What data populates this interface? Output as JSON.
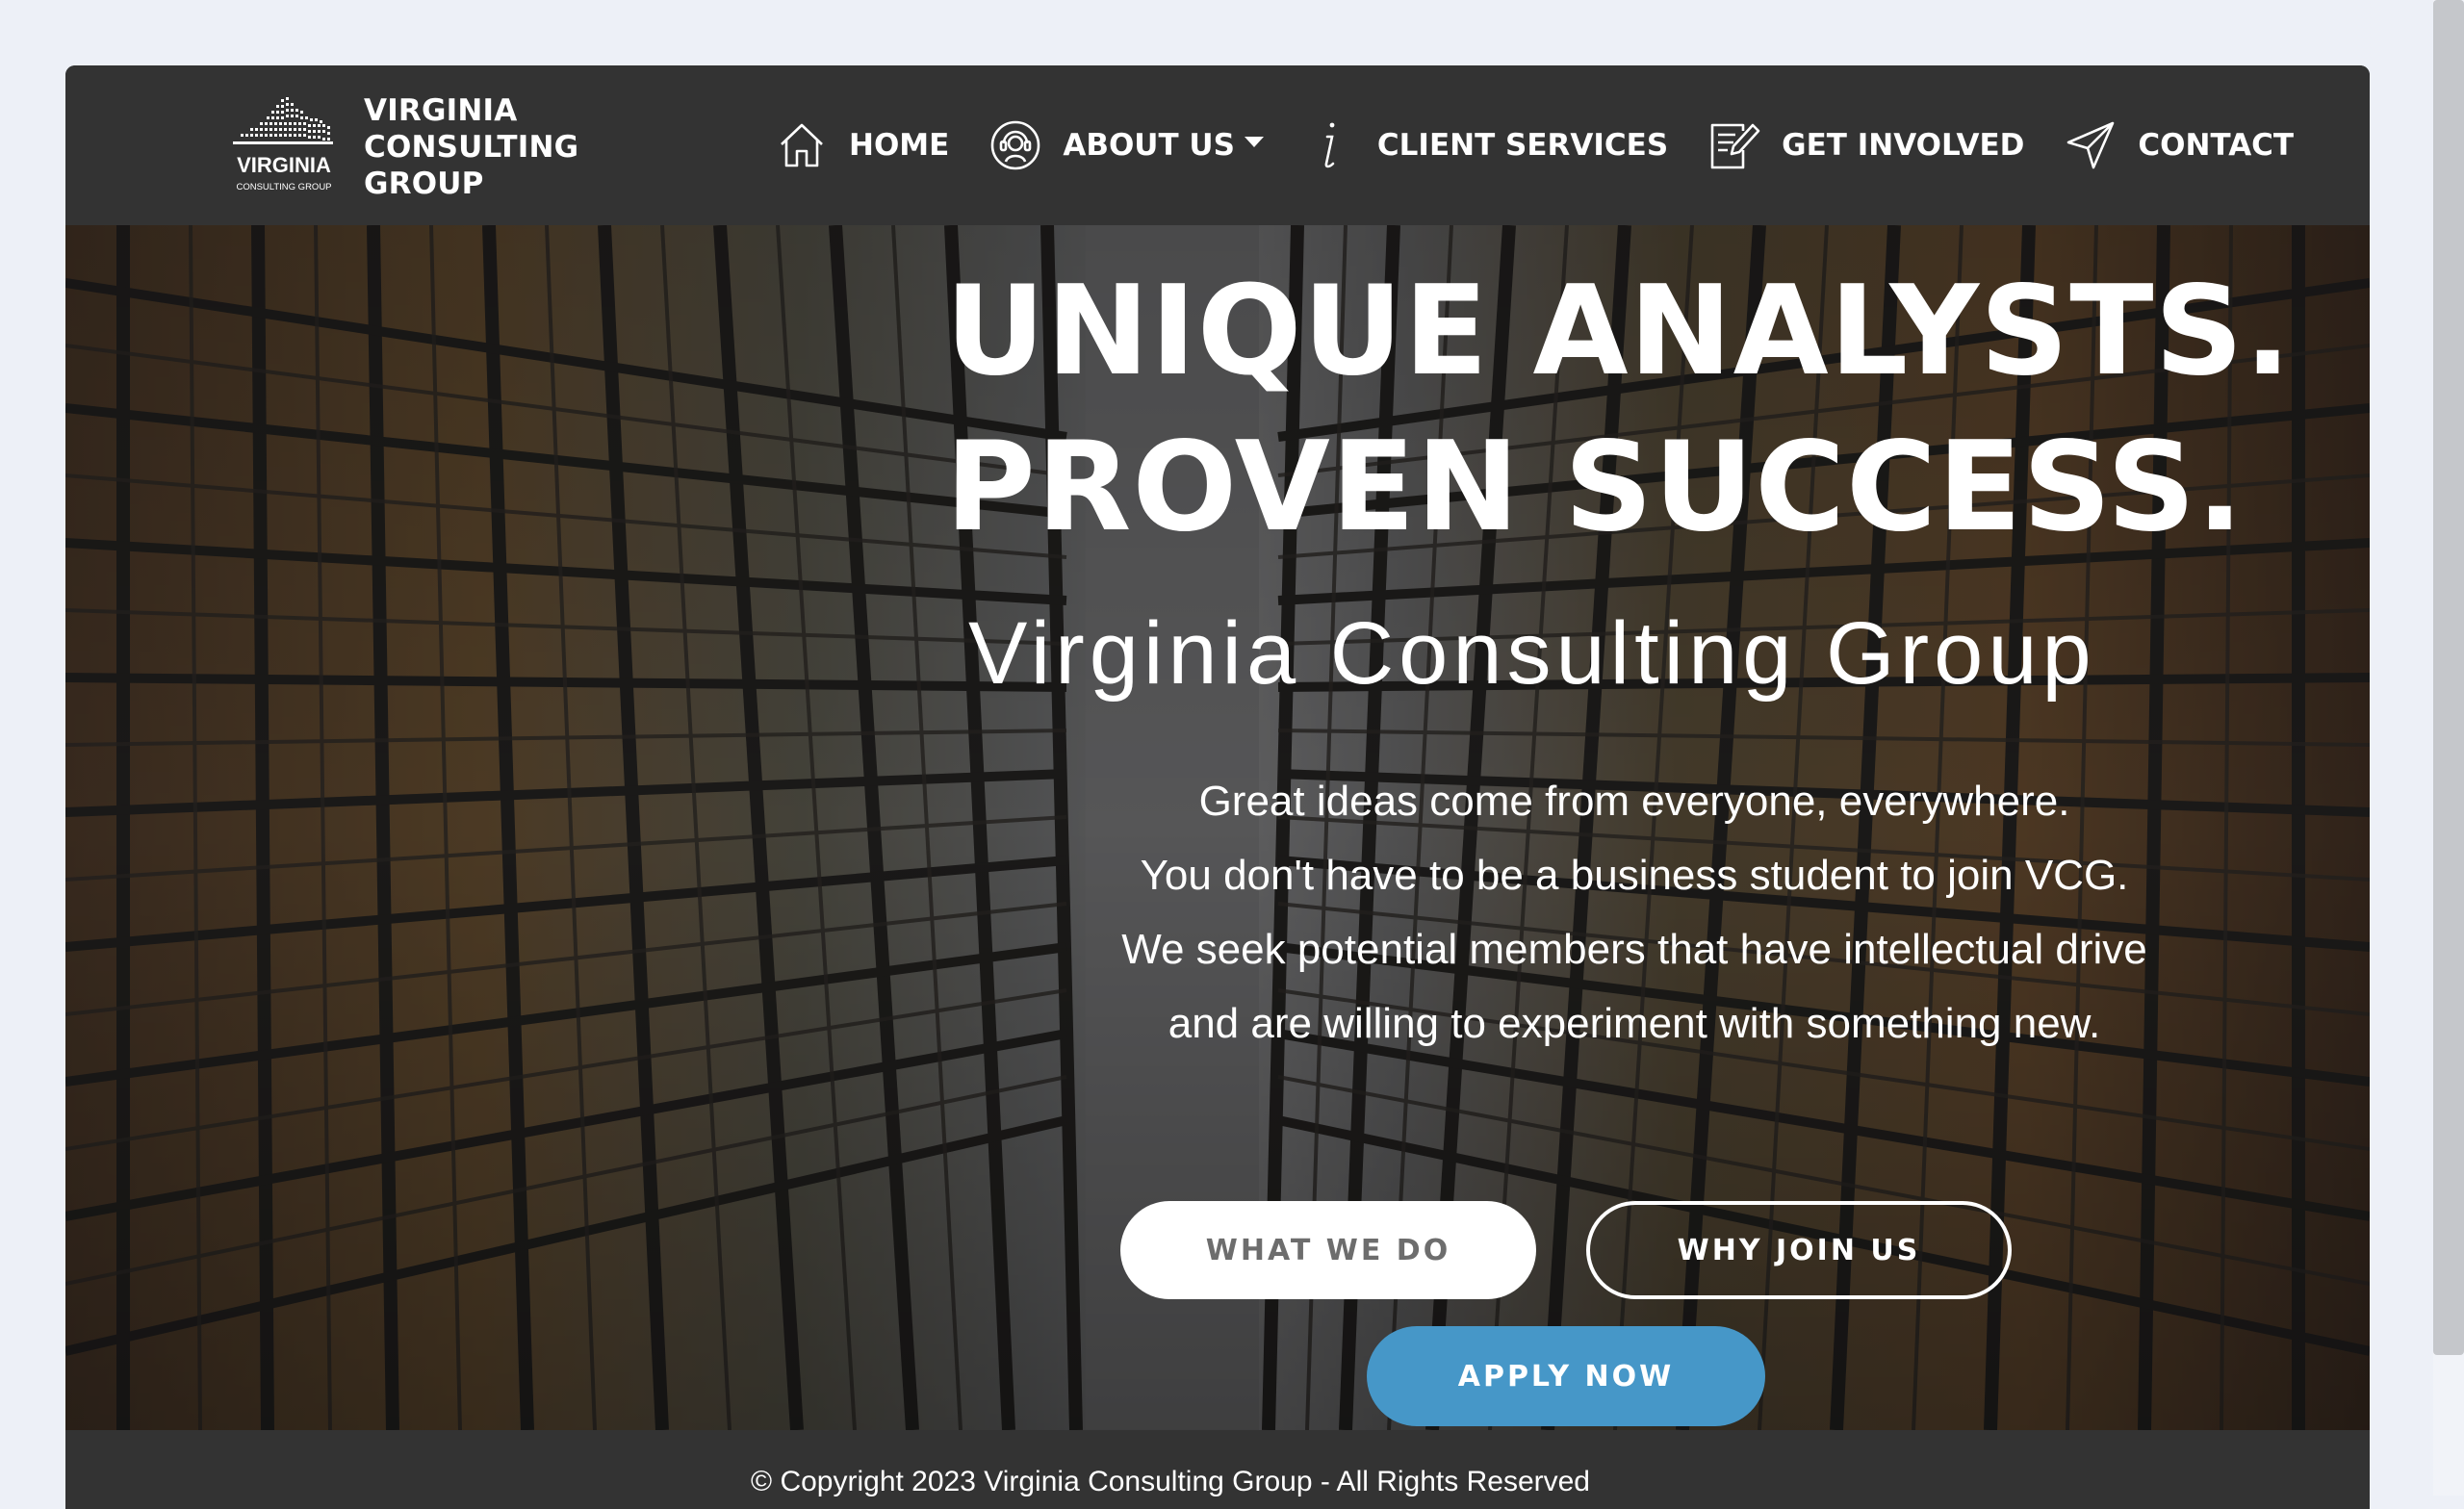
{
  "brand": {
    "logo_text": "VIRGINIA",
    "logo_subtext": "CONSULTING GROUP",
    "name_line1": "VIRGINIA",
    "name_line2": "CONSULTING",
    "name_line3": "GROUP"
  },
  "nav": {
    "items": [
      {
        "label": "HOME",
        "icon": "home-icon"
      },
      {
        "label": "ABOUT US",
        "icon": "support-headset-icon",
        "dropdown": true
      },
      {
        "label": "CLIENT SERVICES",
        "icon": "info-icon"
      },
      {
        "label": "GET INVOLVED",
        "icon": "edit-document-icon"
      },
      {
        "label": "CONTACT",
        "icon": "send-icon"
      }
    ]
  },
  "hero": {
    "headline_line1": "UNIQUE ANALYSTS.",
    "headline_line2": "PROVEN SUCCESS.",
    "org_title": "Virginia Consulting Group",
    "tagline": [
      "Great ideas come from everyone, everywhere.",
      "You don't have to be a business student to join VCG.",
      "We seek potential members that have intellectual drive",
      "and are willing to experiment with something new."
    ],
    "buttons": {
      "what_we_do": "WHAT WE DO",
      "why_join_us": "WHY JOIN US",
      "apply_now": "APPLY NOW"
    }
  },
  "footer": {
    "copyright": "© Copyright 2023 Virginia Consulting Group - All Rights Reserved"
  },
  "colors": {
    "navbar": "#333333",
    "page_background": "#edf0f7",
    "apply_button": "#4697c8",
    "text": "#ffffff"
  }
}
